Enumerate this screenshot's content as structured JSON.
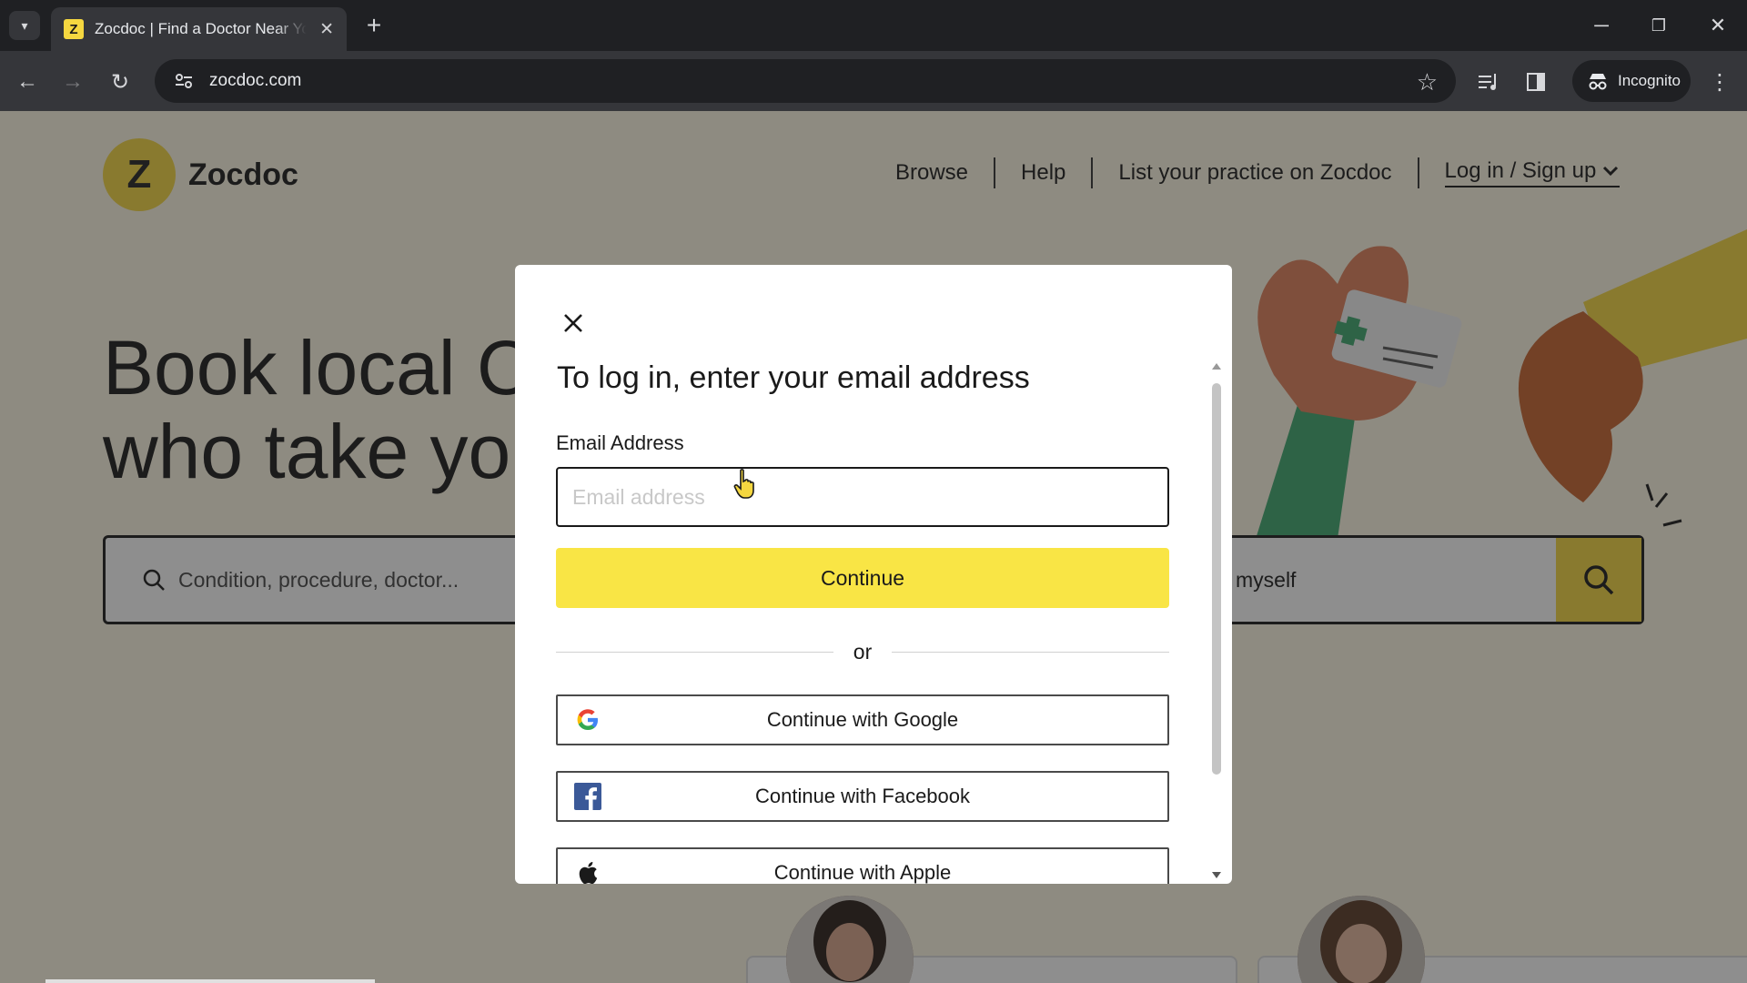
{
  "browser": {
    "tab_title": "Zocdoc | Find a Doctor Near You",
    "tab_favicon_letter": "Z",
    "url": "zocdoc.com",
    "incognito_label": "Incognito"
  },
  "site": {
    "logo_letter": "Z",
    "logo_text": "Zocdoc",
    "nav": [
      "Browse",
      "Help",
      "List your practice on Zocdoc",
      "Log in / Sign up"
    ],
    "hero_line1": "Book local C",
    "hero_line2": "who take yo",
    "search_placeholder": "Condition, procedure, doctor...",
    "insurance_text": "myself",
    "brand_color": "#f5d740"
  },
  "modal": {
    "title": "To log in, enter your email address",
    "email_label": "Email Address",
    "email_placeholder": "Email address",
    "email_value": "",
    "continue_label": "Continue",
    "divider_text": "or",
    "social": [
      {
        "label": "Continue with Google",
        "icon": "google-icon"
      },
      {
        "label": "Continue with Facebook",
        "icon": "facebook-icon"
      },
      {
        "label": "Continue with Apple",
        "icon": "apple-icon"
      }
    ],
    "continue_color": "#f9e545"
  }
}
